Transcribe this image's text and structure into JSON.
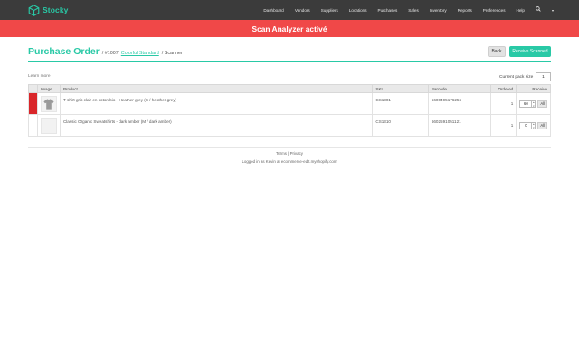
{
  "brand": {
    "name": "Stocky",
    "color": "#29c9a6"
  },
  "nav": {
    "items": [
      "Dashboard",
      "Vendors",
      "Suppliers",
      "Locations",
      "Purchases",
      "Sales",
      "Inventory",
      "Reports",
      "Preferences",
      "Help"
    ],
    "search_icon": "search-icon",
    "caret": "▾"
  },
  "banner": {
    "text": "Scan Analyzer activé",
    "color": "#f04848"
  },
  "header": {
    "title": "Purchase Order",
    "order_prefix": "/ #1007",
    "vendor_link": "Colorful Standard",
    "suffix": "/ Scanner",
    "back_label": "Back",
    "receive_label": "Receive Scanned"
  },
  "learn_more": "Learn more",
  "pack_size": {
    "label": "Current pack size",
    "value": "1"
  },
  "table": {
    "headers": [
      "Image",
      "Product",
      "SKU",
      "Barcode",
      "Ordered",
      "Receive"
    ],
    "rows": [
      {
        "flag": "!",
        "product": "T-shirt gris clair en coton bio - Heather grey (S / heather grey)",
        "sku": "CS1301",
        "barcode": "5600495176256",
        "ordered": "1",
        "receive": "60",
        "all_label": "All"
      },
      {
        "flag": "",
        "product": "Classic Organic Sweatshirts - dark amber (M / dark amber)",
        "sku": "CS1310",
        "barcode": "6602591051121",
        "ordered": "1",
        "receive": "0",
        "all_label": "All"
      }
    ]
  },
  "footer": {
    "links": "Terms | Privacy",
    "logged_in": "Logged in as Kevin at ecommerce-edit.myshopify.com"
  }
}
